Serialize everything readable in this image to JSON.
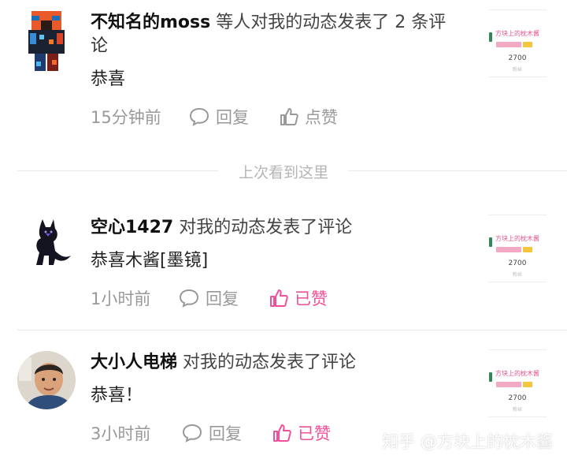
{
  "notifications": [
    {
      "user": "不知名的moss",
      "action_line1": " 等人对我的动态发表了 2 条评",
      "action_line2": "论",
      "comment": "恭喜",
      "time": "15分钟前",
      "reply_label": "回复",
      "like_label": "点赞",
      "liked": false
    },
    {
      "user": "空心1427",
      "action": " 对我的动态发表了评论",
      "comment": "恭喜木酱[墨镜]",
      "time": "1小时前",
      "reply_label": "回复",
      "like_label": "已赞",
      "liked": true
    },
    {
      "user": "大小人电梯",
      "action": " 对我的动态发表了评论",
      "comment": "恭喜！",
      "time": "3小时前",
      "reply_label": "回复",
      "like_label": "已赞",
      "liked": true
    }
  ],
  "divider": "上次看到这里",
  "card": {
    "title": "方块上的枕木酱",
    "count": "2700",
    "sub": "粉丝"
  },
  "watermark": "知乎 @方块上的枕木酱",
  "colors": {
    "liked": "#f0509a",
    "muted": "#999999",
    "card_title": "#e0568e"
  }
}
